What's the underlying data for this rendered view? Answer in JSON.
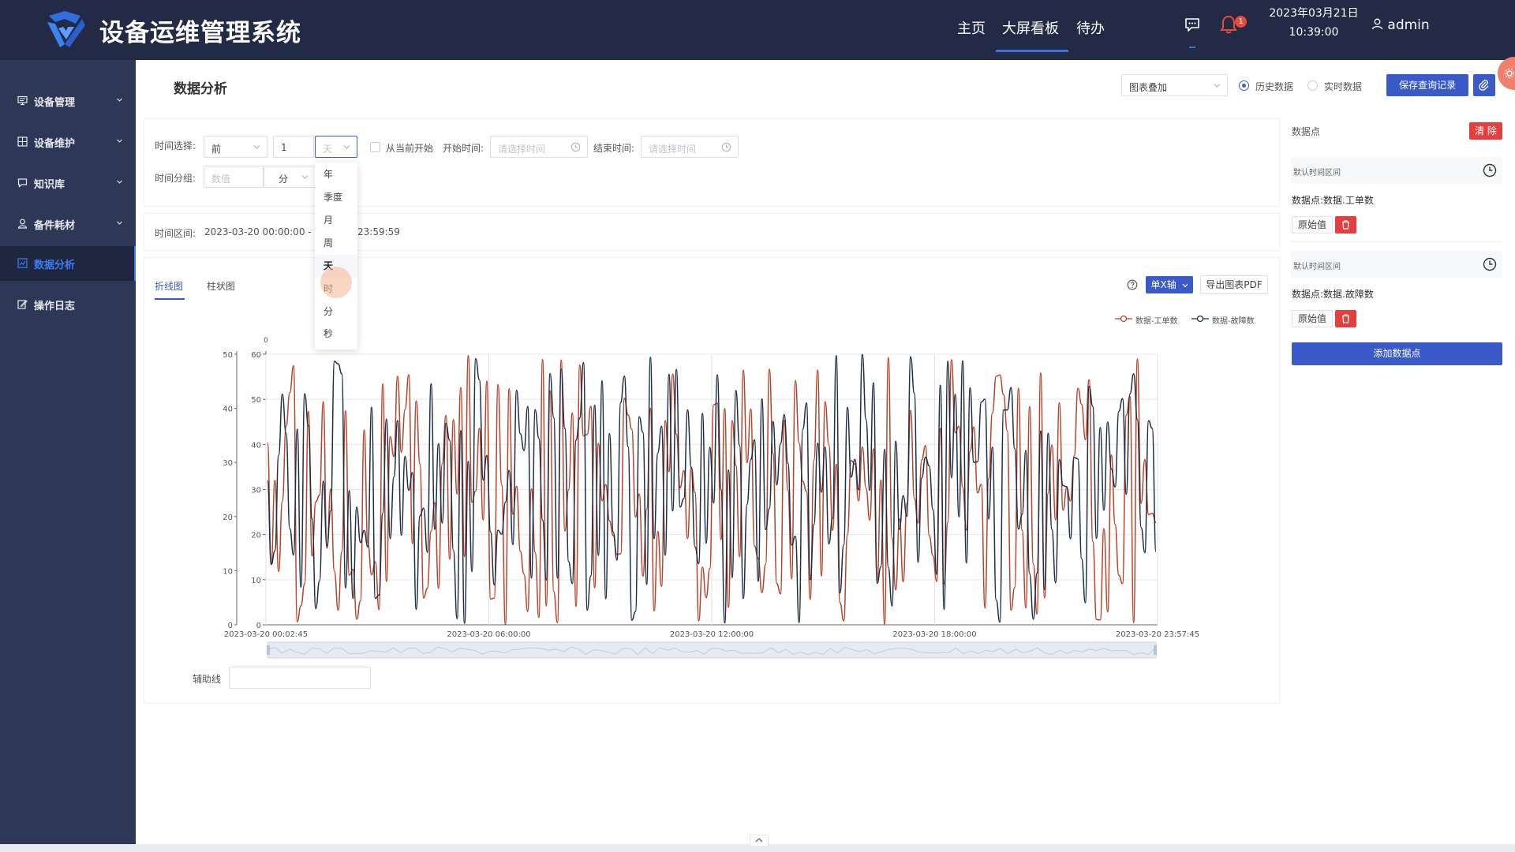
{
  "header": {
    "app_title": "设备运维管理系统",
    "nav": [
      "主页",
      "大屏看板",
      "待办"
    ],
    "notification_count": "1",
    "date": "2023年03月21日",
    "time": "10:39:00",
    "user": "admin"
  },
  "sidebar": {
    "items": [
      {
        "label": "设备管理",
        "icon": "monitor-icon",
        "chevron": true
      },
      {
        "label": "设备维护",
        "icon": "tool-icon",
        "chevron": true
      },
      {
        "label": "知识库",
        "icon": "chat-icon",
        "chevron": true
      },
      {
        "label": "备件耗材",
        "icon": "person-icon",
        "chevron": true
      },
      {
        "label": "数据分析",
        "icon": "chart-icon",
        "chevron": false
      },
      {
        "label": "操作日志",
        "icon": "edit-icon",
        "chevron": false
      }
    ],
    "active": "数据分析"
  },
  "page": {
    "title": "数据分析",
    "toolbar": {
      "chart_mode": "图表叠加",
      "radio_history": "历史数据",
      "radio_realtime": "实时数据",
      "save_button": "保存查询记录"
    }
  },
  "filters": {
    "time_select_label": "时间选择:",
    "direction": "前",
    "amount": "1",
    "unit": "天",
    "from_now_label": "从当前开始",
    "start_label": "开始时间:",
    "start_placeholder": "请选择时间",
    "end_label": "结束时间:",
    "end_placeholder": "请选择时间",
    "group_label": "时间分组:",
    "group_placeholder": "数值",
    "group_unit": "分",
    "range_label": "时间区间:",
    "range_value_left": "2023-03-20 00:00:00 - 20",
    "range_value_right": "23:59:59"
  },
  "unit_dropdown": {
    "options": [
      "年",
      "季度",
      "月",
      "周",
      "天",
      "时",
      "分",
      "秒"
    ],
    "selected": "天"
  },
  "chart_tabs": [
    "折线图",
    "柱状图"
  ],
  "chart_tools": {
    "axis_mode": "单X轴",
    "export_button": "导出图表PDF",
    "aux_line_label": "辅助线"
  },
  "data_points": {
    "title": "数据点",
    "clear_button": "清 除",
    "items": [
      {
        "range_label": "默认时间区间",
        "name": "数据点:数据.工单数",
        "tag": "原始值"
      },
      {
        "range_label": "默认时间区间",
        "name": "数据点:数据.故障数",
        "tag": "原始值"
      }
    ],
    "add_button": "添加数据点"
  },
  "chart_data": {
    "type": "line",
    "x_ticks": [
      "2023-03-20 00:02:45",
      "2023-03-20 06:00:00",
      "2023-03-20 12:00:00",
      "2023-03-20 18:00:00",
      "2023-03-20 23:57:45"
    ],
    "y_left_ticks": [
      0,
      10,
      20,
      30,
      40,
      50
    ],
    "y_right_ticks": [
      0,
      10,
      20,
      30,
      40,
      50,
      60
    ],
    "y_right_top_label": "0",
    "ylim_left": [
      0,
      50
    ],
    "ylim_right": [
      0,
      60
    ],
    "grid": true,
    "legend_position": "top-right",
    "series": [
      {
        "name": "数据-工单数",
        "color": "#b8432b",
        "axis": "right"
      },
      {
        "name": "数据-故障数",
        "color": "#1e2f45",
        "axis": "left"
      }
    ],
    "sample_count": 240
  }
}
